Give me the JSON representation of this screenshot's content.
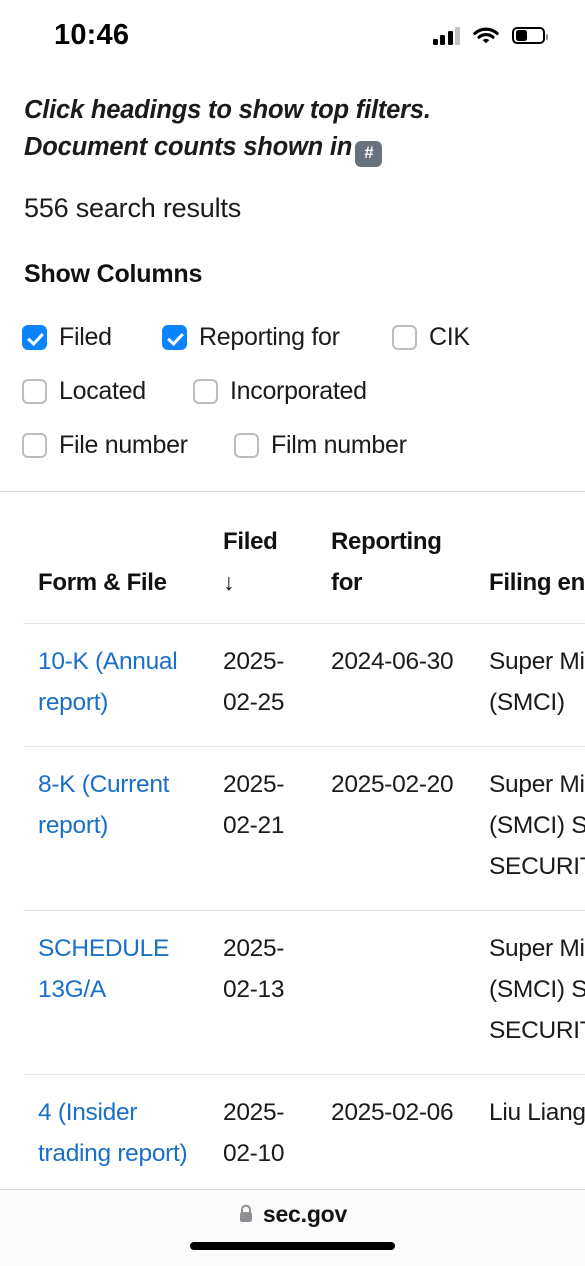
{
  "status_bar": {
    "time": "10:46",
    "signal_icon": "cellular-signal-icon",
    "wifi_icon": "wifi-icon",
    "battery_icon": "battery-icon",
    "battery_level_percent": 38
  },
  "page": {
    "hint_line_1": "Click headings to show top filters.",
    "hint_line_2": "Document counts shown in",
    "hint_badge": "#",
    "results_count": "556 search results",
    "show_columns_title": "Show Columns"
  },
  "show_columns": {
    "rows": [
      [
        {
          "label": "Filed",
          "checked": true
        },
        {
          "label": "Reporting for",
          "checked": true
        },
        {
          "label": "CIK",
          "checked": false
        }
      ],
      [
        {
          "label": "Located",
          "checked": false
        },
        {
          "label": "Incorporated",
          "checked": false
        }
      ],
      [
        {
          "label": "File number",
          "checked": false
        },
        {
          "label": "Film number",
          "checked": false
        }
      ]
    ]
  },
  "table": {
    "headers": [
      {
        "label": "Form & File",
        "sort": ""
      },
      {
        "label": "Filed",
        "sort": "↓"
      },
      {
        "label": "Reporting for",
        "sort": ""
      },
      {
        "label": "Filing entity/person",
        "sort": ""
      }
    ],
    "rows": [
      {
        "form": "10-K (Annual report)",
        "filed": "2025-02-25",
        "reporting_for": "2024-06-30",
        "entity": "Super Micro Computer Inc (SMCI)"
      },
      {
        "form": "8-K (Current report)",
        "filed": "2025-02-21",
        "reporting_for": "2025-02-20",
        "entity": "Super Micro Computer Inc (SMCI) SUSQUEHANNA SECURITIES, LLC"
      },
      {
        "form": "SCHEDULE 13G/A",
        "filed": "2025-02-13",
        "reporting_for": "",
        "entity": "Super Micro Computer Inc (SMCI) SUSQUEHANNA SECURITIES, LLC"
      },
      {
        "form": "4 (Insider trading report)",
        "filed": "2025-02-10",
        "reporting_for": "2025-02-06",
        "entity": "Liu Liang"
      }
    ]
  },
  "browser_bar": {
    "lock_icon": "lock-icon",
    "url": "sec.gov"
  },
  "colors": {
    "link": "#1a6fc9",
    "checkbox_on": "#0a84ff",
    "badge_bg": "#68727d",
    "divider": "#e3e4e6"
  }
}
